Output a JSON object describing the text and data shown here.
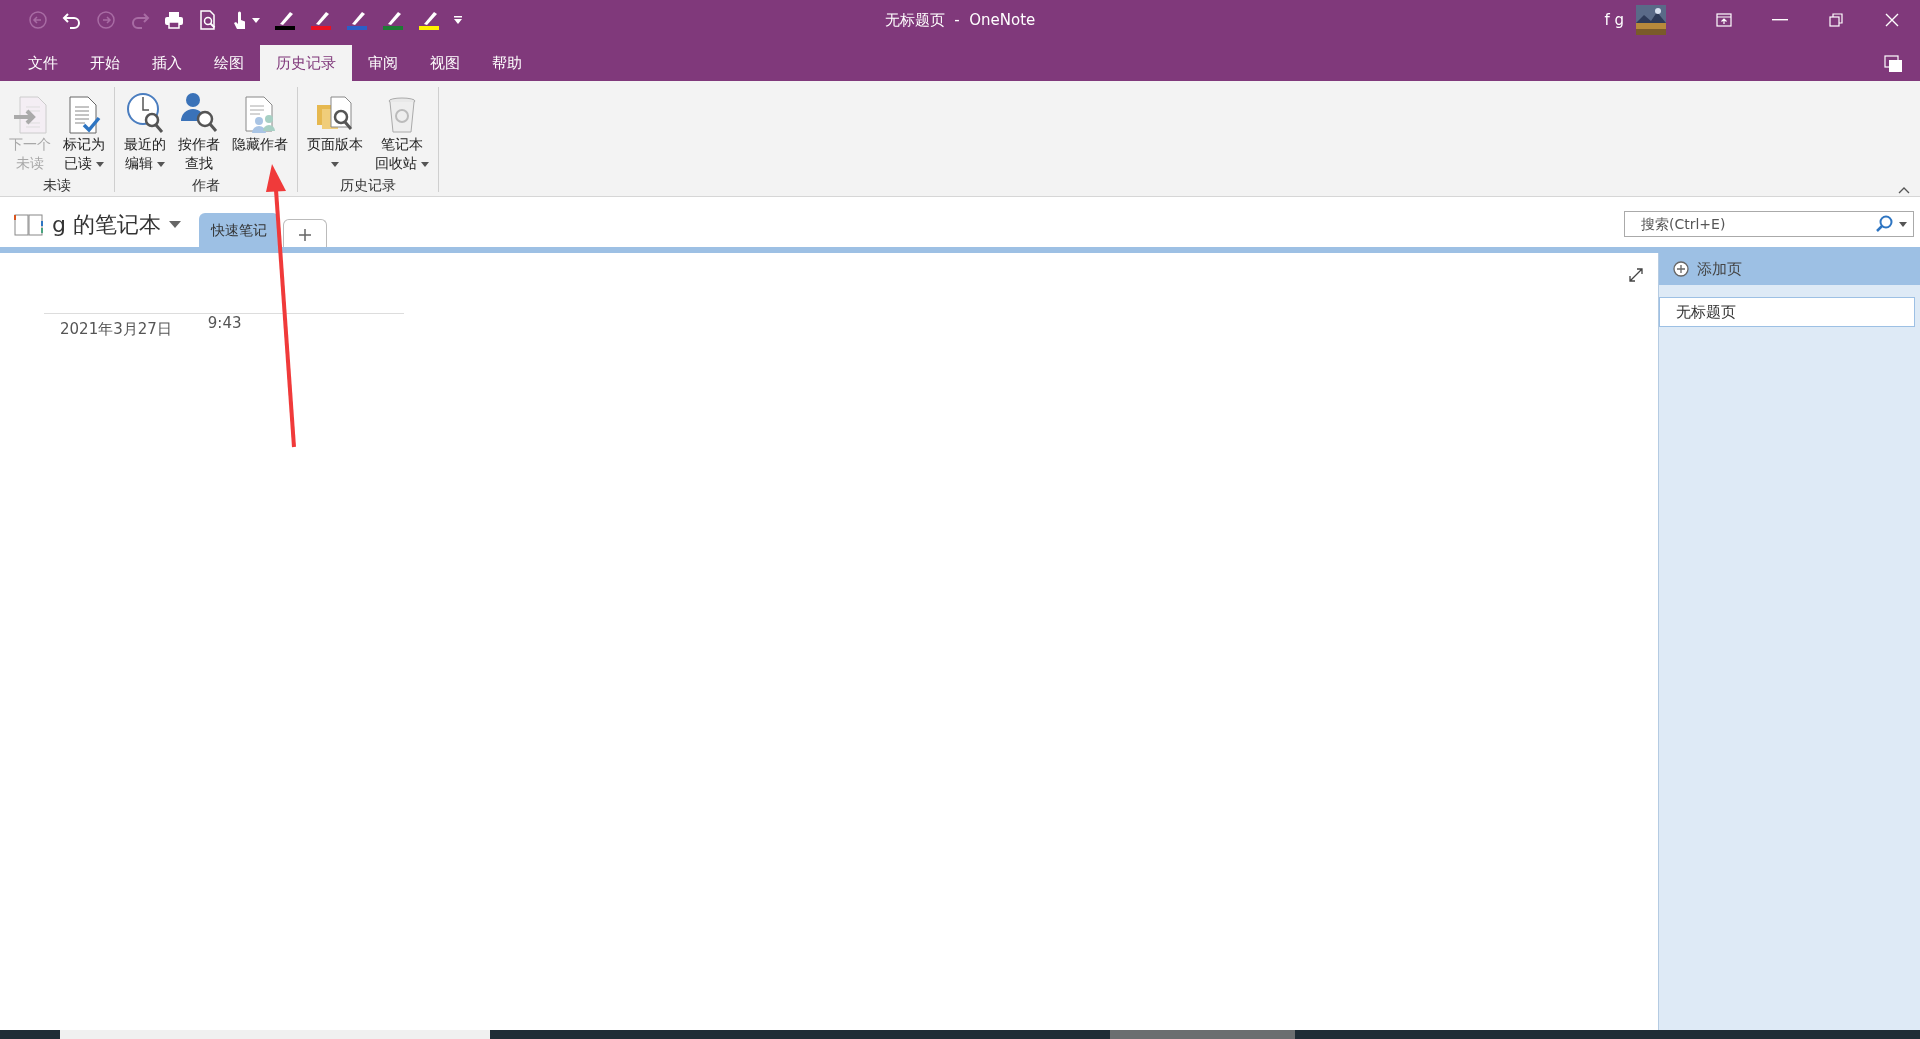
{
  "quick_access": [
    {
      "kind": "back",
      "disabled": true
    },
    {
      "kind": "undo",
      "disabled": false
    },
    {
      "kind": "forward",
      "disabled": true
    },
    {
      "kind": "redo",
      "disabled": true
    },
    {
      "kind": "print",
      "disabled": false
    },
    {
      "kind": "preview",
      "disabled": false
    },
    {
      "kind": "touch",
      "disabled": false
    },
    {
      "kind": "pen",
      "color": "#000000"
    },
    {
      "kind": "pen",
      "color": "#e81123"
    },
    {
      "kind": "pen",
      "color": "#2b5fc7"
    },
    {
      "kind": "pen",
      "color": "#1e7b34"
    },
    {
      "kind": "pen",
      "color": "#fff100"
    },
    {
      "kind": "customize"
    }
  ],
  "window": {
    "title": "无标题页  -  OneNote",
    "user": "f g"
  },
  "menu_tabs": [
    {
      "label": "文件",
      "selected": false
    },
    {
      "label": "开始",
      "selected": false
    },
    {
      "label": "插入",
      "selected": false
    },
    {
      "label": "绘图",
      "selected": false
    },
    {
      "label": "历史记录",
      "selected": true
    },
    {
      "label": "审阅",
      "selected": false
    },
    {
      "label": "视图",
      "selected": false
    },
    {
      "label": "帮助",
      "selected": false
    }
  ],
  "ribbon_groups": [
    {
      "label": "未读",
      "buttons": [
        {
          "kind": "next-unread",
          "lines": [
            "下一个",
            "未读"
          ],
          "disabled": true,
          "dropdown": false
        },
        {
          "kind": "mark-read",
          "lines": [
            "标记为",
            "已读"
          ],
          "disabled": false,
          "dropdown": true
        }
      ]
    },
    {
      "label": "作者",
      "buttons": [
        {
          "kind": "recent",
          "lines": [
            "最近的",
            "编辑"
          ],
          "disabled": false,
          "dropdown": true
        },
        {
          "kind": "find-author",
          "lines": [
            "按作者",
            "查找"
          ],
          "disabled": false,
          "dropdown": false
        },
        {
          "kind": "hide-author",
          "lines": [
            "隐藏作者"
          ],
          "disabled": false,
          "dropdown": false
        }
      ]
    },
    {
      "label": "历史记录",
      "buttons": [
        {
          "kind": "versions",
          "lines": [
            "页面版本"
          ],
          "disabled": false,
          "dropdown": true
        },
        {
          "kind": "recycle",
          "lines": [
            "笔记本",
            "回收站"
          ],
          "disabled": false,
          "dropdown": true
        }
      ]
    }
  ],
  "notebook": {
    "name": "g 的笔记本"
  },
  "sections": [
    {
      "label": "快速笔记",
      "selected": true
    }
  ],
  "search": {
    "placeholder": "搜索(Ctrl+E)"
  },
  "page": {
    "date": "2021年3月27日",
    "time": "9:43"
  },
  "page_list": {
    "add_label": "添加页",
    "pages": [
      {
        "title": "无标题页",
        "selected": true
      }
    ]
  }
}
